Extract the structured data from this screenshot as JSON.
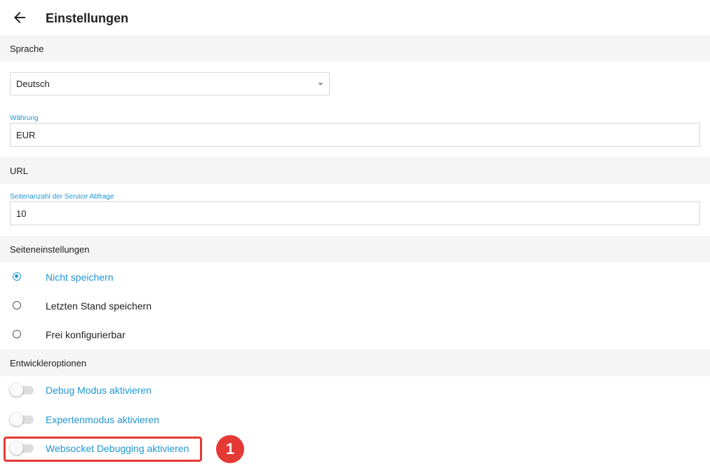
{
  "header": {
    "title": "Einstellungen",
    "back_icon": "arrow-left-icon"
  },
  "sections": {
    "language": "Sprache",
    "url": "URL",
    "page_settings": "Seiteneinstellungen",
    "developer": "Entwickleroptionen"
  },
  "language_select": {
    "value": "Deutsch",
    "icon": "dropdown-arrow-icon"
  },
  "currency": {
    "label": "Währung",
    "value": "EUR"
  },
  "page_count": {
    "label": "Seitenanzahl der Service Abfrage",
    "value": "10"
  },
  "page_settings_options": [
    {
      "label": "Nicht speichern",
      "checked": true
    },
    {
      "label": "Letzten Stand speichern",
      "checked": false
    },
    {
      "label": "Frei konfigurierbar",
      "checked": false
    }
  ],
  "developer_toggles": [
    {
      "label": "Debug Modus aktivieren",
      "on": false
    },
    {
      "label": "Expertenmodus aktivieren",
      "on": false
    },
    {
      "label": "Websocket Debugging aktivieren",
      "on": false
    }
  ],
  "annotation": {
    "badge": "1",
    "color": "#e53935"
  },
  "colors": {
    "accent": "#2196d3",
    "section_bg": "#f5f5f5"
  }
}
